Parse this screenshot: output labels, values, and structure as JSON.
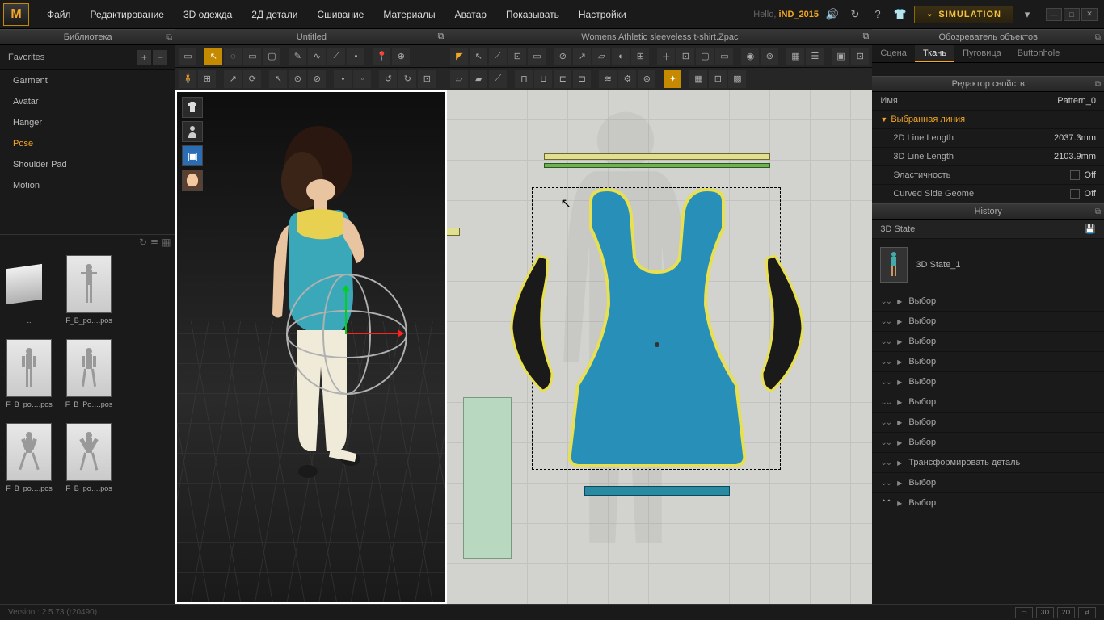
{
  "menubar": {
    "items": [
      "Файл",
      "Редактирование",
      "3D одежда",
      "2Д детали",
      "Сшивание",
      "Материалы",
      "Аватар",
      "Показывать",
      "Настройки"
    ],
    "hello_prefix": "Hello, ",
    "user": "iND_2015",
    "sim_label": "SIMULATION"
  },
  "library": {
    "title": "Библиотека",
    "favorites": "Favorites",
    "items": [
      "Garment",
      "Avatar",
      "Hanger",
      "Pose",
      "Shoulder Pad",
      "Motion"
    ],
    "active_index": 3,
    "thumbs": [
      {
        "label": "..",
        "folder": true
      },
      {
        "label": "F_B_po….pos"
      },
      {
        "label": "F_B_po….pos"
      },
      {
        "label": "F_B_Po….pos"
      },
      {
        "label": "F_B_po….pos"
      },
      {
        "label": "F_B_po….pos"
      }
    ]
  },
  "viewport3d": {
    "title": "Untitled"
  },
  "viewport2d": {
    "title": "Womens Athletic sleeveless t-shirt.Zpac"
  },
  "object_browser": {
    "title": "Обозреватель объектов",
    "tabs": [
      "Сцена",
      "Ткань",
      "Пуговица",
      "Buttonhole"
    ],
    "active_tab": 1
  },
  "property_editor": {
    "title": "Редактор свойств",
    "name_label": "Имя",
    "name_value": "Pattern_0",
    "section": "Выбранная линия",
    "rows": [
      {
        "k": "2D Line Length",
        "v": "2037.3mm"
      },
      {
        "k": "3D Line Length",
        "v": "2103.9mm"
      },
      {
        "k": "Эластичность",
        "v": "Off",
        "chk": true
      },
      {
        "k": "Curved Side Geome",
        "v": "Off",
        "chk": true
      }
    ]
  },
  "history": {
    "title": "History",
    "state_label": "3D State",
    "state_name": "3D State_1",
    "rows": [
      "Выбор",
      "Выбор",
      "Выбор",
      "Выбор",
      "Выбор",
      "Выбор",
      "Выбор",
      "Выбор",
      "Трансформировать деталь",
      "Выбор",
      "Выбор"
    ]
  },
  "statusbar": {
    "version": "Version : 2.5.73   (r20490)",
    "modes": [
      "3D",
      "2D"
    ]
  }
}
